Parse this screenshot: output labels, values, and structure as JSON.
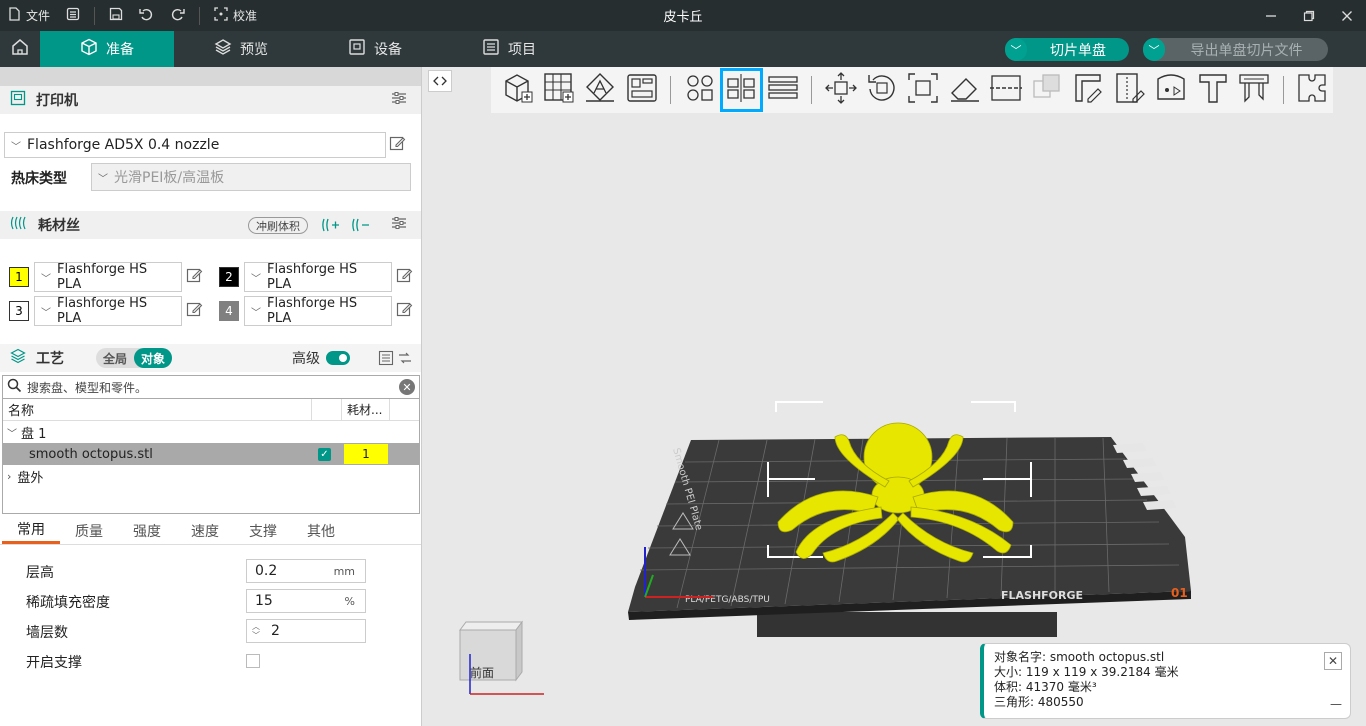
{
  "titlebar": {
    "file_label": "文件",
    "calibrate_label": "校准",
    "app_title": "皮卡丘"
  },
  "tabs": {
    "prepare": "准备",
    "preview": "预览",
    "device": "设备",
    "project": "项目"
  },
  "actions": {
    "slice": "切片单盘",
    "export": "导出单盘切片文件"
  },
  "printer": {
    "section_title": "打印机",
    "selected": "Flashforge AD5X 0.4 nozzle",
    "bed_label": "热床类型",
    "bed_value": "光滑PEI板/高温板"
  },
  "filament": {
    "section_title": "耗材丝",
    "flush_label": "冲刷体积",
    "slots": [
      {
        "num": "1",
        "name": "Flashforge HS PLA",
        "color": "#ffff00",
        "text": "#000000"
      },
      {
        "num": "2",
        "name": "Flashforge HS PLA",
        "color": "#000000",
        "text": "#ffffff"
      },
      {
        "num": "3",
        "name": "Flashforge HS PLA",
        "color": "#ffffff",
        "text": "#000000"
      },
      {
        "num": "4",
        "name": "Flashforge HS PLA",
        "color": "#808080",
        "text": "#ffffff"
      }
    ]
  },
  "process": {
    "section_title": "工艺",
    "global_label": "全局",
    "object_label": "对象",
    "advanced_label": "高级",
    "search_placeholder": "搜索盘、模型和零件。"
  },
  "tree": {
    "col_name": "名称",
    "col_filament": "耗材...",
    "plate": "盘 1",
    "object": "smooth octopus.stl",
    "object_filament": "1",
    "outside": "盘外"
  },
  "param_tabs": [
    "常用",
    "质量",
    "强度",
    "速度",
    "支撑",
    "其他"
  ],
  "params": {
    "layer_height_label": "层高",
    "layer_height_value": "0.2",
    "layer_height_unit": "mm",
    "infill_label": "稀疏填充密度",
    "infill_value": "15",
    "infill_unit": "%",
    "walls_label": "墙层数",
    "walls_value": "2",
    "support_label": "开启支撑"
  },
  "viewport": {
    "cube_label": "前面",
    "plate_brand": "FLASHFORGE",
    "plate_materials": "PLA/PETG/ABS/TPU",
    "plate_number": "01",
    "plate_title": "Smooth PEI Plate"
  },
  "info": {
    "name_line": "对象名字:  smooth octopus.stl",
    "size_line": "大小:    119 x 119 x 39.2184 毫米",
    "volume_line": "体积:    41370 毫米³",
    "triangles_line": "三角形:   480550"
  },
  "colors": {
    "accent": "#009688",
    "highlight": "#00aaff",
    "model": "#e6e600"
  }
}
